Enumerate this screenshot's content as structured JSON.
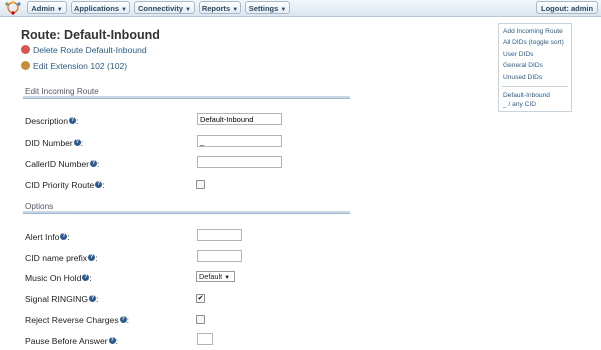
{
  "nav": {
    "menus": [
      "Admin",
      "Applications",
      "Connectivity",
      "Reports",
      "Settings"
    ],
    "logout": "Logout: admin"
  },
  "page": {
    "title": "Route: Default-Inbound",
    "delete_route": "Delete Route Default-Inbound",
    "edit_extension": "Edit Extension 102 (102)"
  },
  "sections": {
    "edit": "Edit Incoming Route",
    "options": "Options"
  },
  "form": {
    "description": {
      "label": "Description",
      "value": "Default-Inbound"
    },
    "did": {
      "label": "DID Number",
      "value": "_"
    },
    "callerid": {
      "label": "CallerID Number",
      "value": ""
    },
    "cid_priority": {
      "label": "CID Priority Route",
      "checked": false
    },
    "alert_info": {
      "label": "Alert Info",
      "value": ""
    },
    "cid_prefix": {
      "label": "CID name prefix",
      "value": ""
    },
    "moh": {
      "label": "Music On Hold",
      "value": "Default"
    },
    "signal_ringing": {
      "label": "Signal RINGING",
      "checked": true
    },
    "reject_reverse": {
      "label": "Reject Reverse Charges",
      "checked": false
    },
    "pause": {
      "label": "Pause Before Answer",
      "value": ""
    }
  },
  "sidebar": {
    "links": [
      "Add Incoming Route",
      "All DIDs (toggle sort)",
      "User DIDs",
      "General DIDs",
      "Unused DIDs"
    ],
    "routes": [
      "Default-Inbound",
      "_ / any CID"
    ]
  },
  "colors": {
    "link": "#2b5b87",
    "delete": "#d9534f",
    "help": "#2d5c8f"
  }
}
